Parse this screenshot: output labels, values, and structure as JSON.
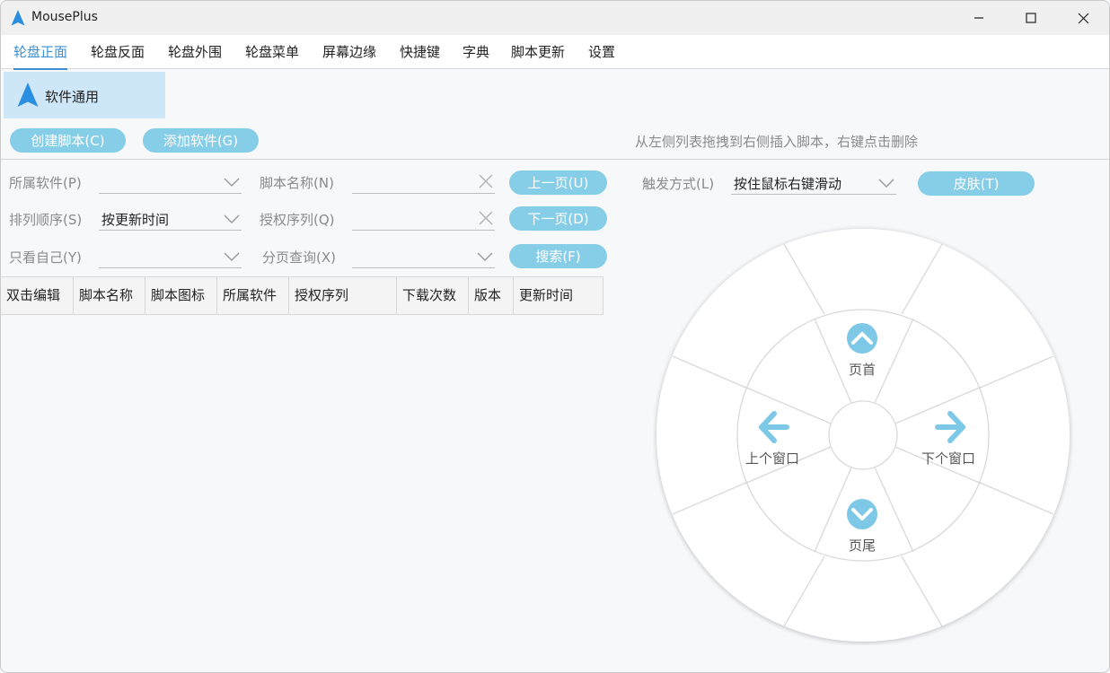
{
  "window": {
    "title": "MousePlus"
  },
  "menu": {
    "tabs": [
      "轮盘正面",
      "轮盘反面",
      "轮盘外围",
      "轮盘菜单",
      "屏幕边缘",
      "快捷键",
      "字典",
      "脚本更新",
      "设置"
    ],
    "active": "轮盘正面"
  },
  "software_list": {
    "items": [
      {
        "label": "软件通用"
      }
    ]
  },
  "actions": {
    "create_script": "创建脚本(C)",
    "add_software": "添加软件(G)",
    "hint": "从左侧列表拖拽到右侧插入脚本，右键点击删除"
  },
  "filters": {
    "software_label": "所属软件(P)",
    "software_value": "",
    "sort_label": "排列顺序(S)",
    "sort_value": "按更新时间",
    "mine_label": "只看自己(Y)",
    "mine_value": "",
    "script_name_label": "脚本名称(N)",
    "script_name_value": "",
    "license_label": "授权序列(Q)",
    "license_value": "",
    "page_query_label": "分页查询(X)",
    "page_query_value": "",
    "prev_page": "上一页(U)",
    "next_page": "下一页(D)",
    "search": "搜索(F)"
  },
  "trigger": {
    "label": "触发方式(L)",
    "value": "按住鼠标右键滑动",
    "skin_button": "皮肤(T)"
  },
  "table": {
    "columns": [
      "双击编辑",
      "脚本名称",
      "脚本图标",
      "所属软件",
      "授权序列",
      "下载次数",
      "版本",
      "更新时间"
    ],
    "rows": []
  },
  "wheel": {
    "top": {
      "label": "页首",
      "icon": "chevron-up-circle-icon"
    },
    "left": {
      "label": "上个窗口",
      "icon": "arrow-left-icon"
    },
    "right": {
      "label": "下个窗口",
      "icon": "arrow-right-icon"
    },
    "bottom": {
      "label": "页尾",
      "icon": "chevron-down-circle-icon"
    }
  },
  "colors": {
    "accent": "#3a8fd3",
    "button": "#86cde8",
    "selected_item": "#cde6f8",
    "icon_blue": "#7cc8e6"
  }
}
